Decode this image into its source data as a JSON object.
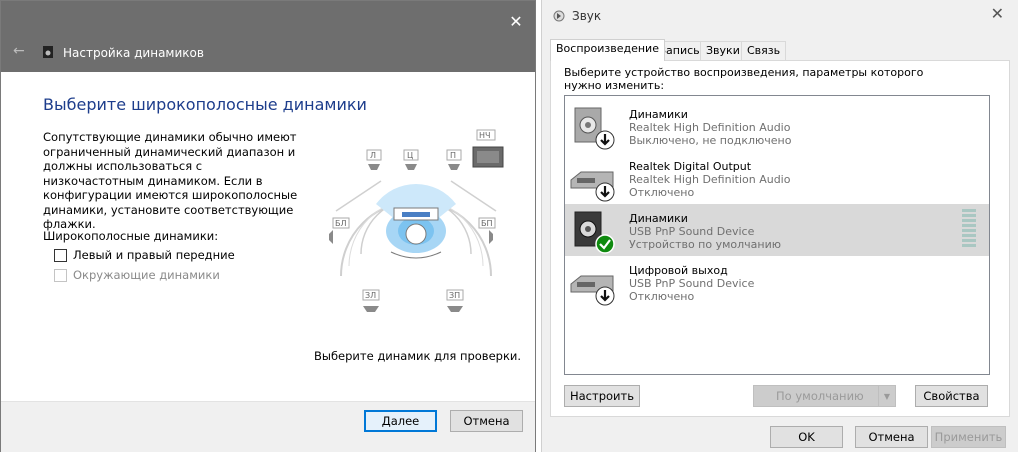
{
  "wizard": {
    "title": "Настройка динамиков",
    "heading": "Выберите широкополосные динамики",
    "description": "Сопутствующие динамики обычно имеют ограниченный динамический диапазон и должны использоваться с низкочастотным динамиком.  Если в конфигурации имеются широкополосные динамики, установите соответствующие флажки.",
    "group_label": "Широкополосные динамики:",
    "checkbox_front": "Левый и правый передние",
    "checkbox_surround": "Окружающие динамики",
    "speaker_labels": {
      "fl": "Л",
      "c": "Ц",
      "fr": "П",
      "sub": "НЧ",
      "sl": "БЛ",
      "sr": "БП",
      "rl": "ЗЛ",
      "rr": "ЗП"
    },
    "hint": "Выберите динамик для проверки.",
    "next_label": "Далее",
    "cancel_label": "Отмена"
  },
  "sound": {
    "title": "Звук",
    "tabs": [
      "Воспроизведение",
      "Запись",
      "Звуки",
      "Связь"
    ],
    "instruction": "Выберите устройство воспроизведения, параметры которого нужно изменить:",
    "devices": [
      {
        "name": "Динамики",
        "driver": "Realtek High Definition Audio",
        "status": "Выключено, не подключено"
      },
      {
        "name": "Realtek Digital Output",
        "driver": "Realtek High Definition Audio",
        "status": "Отключено"
      },
      {
        "name": "Динамики",
        "driver": "USB PnP Sound Device",
        "status": "Устройство по умолчанию"
      },
      {
        "name": "Цифровой выход",
        "driver": "USB PnP Sound Device",
        "status": "Отключено"
      }
    ],
    "configure_label": "Настроить",
    "default_label": "По умолчанию",
    "properties_label": "Свойства",
    "ok_label": "OK",
    "cancel_label": "Отмена",
    "apply_label": "Применить"
  },
  "colors": {
    "chrome": "#6e6e6e",
    "heading": "#1d3d8c",
    "accent": "#0078d7",
    "selection": "#d9d9d9",
    "check_green": "#0f8a0f"
  }
}
